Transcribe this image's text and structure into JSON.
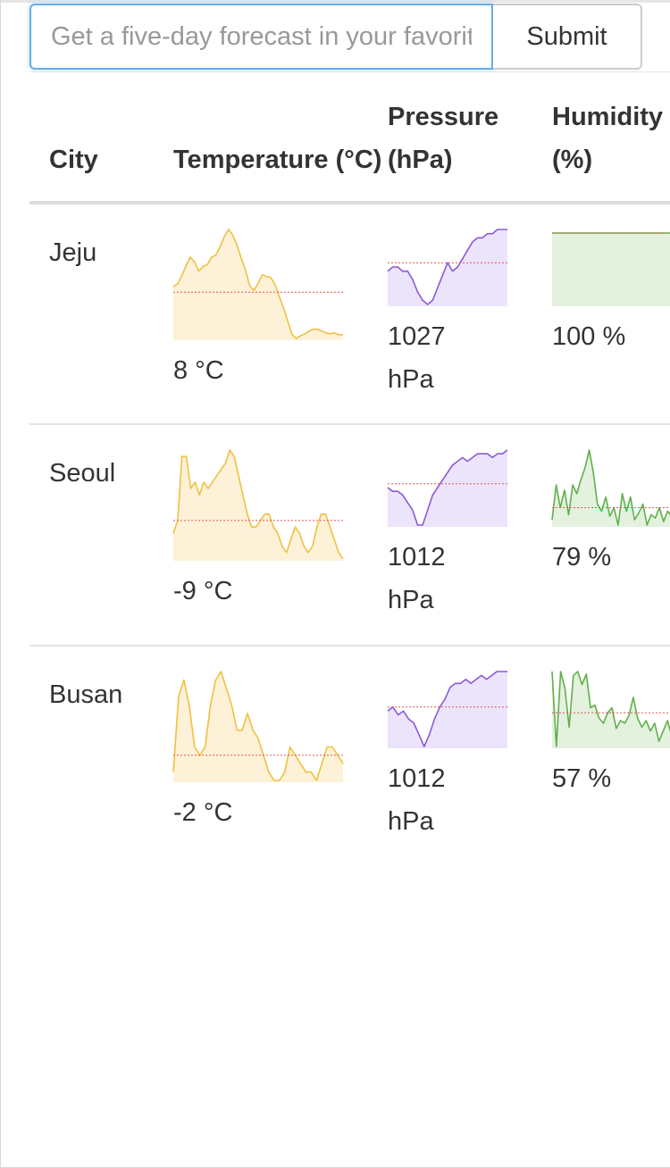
{
  "search": {
    "placeholder": "Get a five-day forecast in your favorite cities",
    "value": "",
    "submit_label": "Submit"
  },
  "table": {
    "headers": {
      "city": "City",
      "temperature": "Temperature (°C)",
      "pressure": "Pressure (hPa)",
      "humidity": "Humidity (%)"
    },
    "rows": [
      {
        "city": "Jeju",
        "temperature": "8 °C",
        "pressure_value": "1027",
        "pressure_unit": "hPa",
        "humidity": "100 %"
      },
      {
        "city": "Seoul",
        "temperature": "-9 °C",
        "pressure_value": "1012",
        "pressure_unit": "hPa",
        "humidity": "79 %"
      },
      {
        "city": "Busan",
        "temperature": "-2 °C",
        "pressure_value": "1012",
        "pressure_unit": "hPa",
        "humidity": "57 %"
      }
    ]
  },
  "colors": {
    "temperature_line": "#f0c040",
    "temperature_fill": "#fdf1d8",
    "pressure_line": "#8a5ad8",
    "pressure_fill": "#ece4fb",
    "humidity_line": "#5fb04a",
    "humidity_fill": "#e3f1de",
    "average_line": "#e35454",
    "input_focus_border": "#66afe9"
  },
  "chart_data": [
    {
      "type": "area",
      "metric": "temperature",
      "city": "Jeju",
      "values": [
        2.0,
        2.3,
        3.2,
        4.3,
        5.2,
        4.7,
        3.7,
        4.2,
        4.4,
        5.2,
        5.4,
        6.3,
        7.4,
        8.2,
        7.6,
        6.5,
        5.1,
        3.8,
        2.1,
        1.6,
        2.4,
        3.3,
        3.1,
        3.0,
        2.2,
        0.9,
        -0.3,
        -1.8,
        -3.2,
        -3.6,
        -3.3,
        -3.1,
        -2.8,
        -2.6,
        -2.6,
        -2.8,
        -3.0,
        -3.1,
        -3.0,
        -3.2,
        -3.2
      ],
      "average": 1.4
    },
    {
      "type": "area",
      "metric": "pressure",
      "city": "Jeju",
      "values": [
        1023,
        1024,
        1024,
        1023,
        1023,
        1021,
        1018,
        1016,
        1015,
        1016,
        1019,
        1022,
        1025,
        1023,
        1024,
        1026,
        1028,
        1030,
        1031,
        1031,
        1032,
        1032,
        1033,
        1033,
        1033
      ],
      "average": 1025
    },
    {
      "type": "area",
      "metric": "humidity",
      "city": "Jeju",
      "values": [
        100,
        100,
        100,
        100,
        100,
        100,
        100,
        100,
        100,
        100
      ],
      "average": 100
    },
    {
      "type": "area",
      "metric": "temperature",
      "city": "Seoul",
      "values": [
        -10,
        -8,
        2,
        2,
        -3,
        -2,
        -4,
        -2,
        -3,
        -2,
        -1,
        0,
        1,
        3,
        2,
        -1,
        -4,
        -7,
        -9,
        -9,
        -8,
        -7,
        -7,
        -9,
        -10,
        -12,
        -13,
        -11,
        -9,
        -10,
        -12,
        -13,
        -12,
        -9,
        -7,
        -7,
        -9,
        -11,
        -13,
        -14
      ],
      "average": -8
    },
    {
      "type": "area",
      "metric": "pressure",
      "city": "Seoul",
      "values": [
        1015,
        1014,
        1014,
        1013,
        1011,
        1009,
        1005,
        1005,
        1009,
        1013,
        1015,
        1017,
        1019,
        1021,
        1022,
        1023,
        1022,
        1023,
        1024,
        1024,
        1024,
        1023,
        1024,
        1024,
        1025
      ],
      "average": 1016
    },
    {
      "type": "area",
      "metric": "humidity",
      "city": "Seoul",
      "values": [
        55,
        75,
        62,
        72,
        58,
        75,
        70,
        78,
        85,
        95,
        82,
        64,
        60,
        68,
        57,
        62,
        52,
        70,
        60,
        68,
        55,
        59,
        64,
        52,
        58,
        56,
        62,
        54,
        60,
        57
      ],
      "average": 62
    },
    {
      "type": "area",
      "metric": "temperature",
      "city": "Busan",
      "values": [
        -3,
        6,
        8,
        5,
        0,
        -1,
        0,
        5,
        8,
        9,
        7,
        5,
        2,
        2,
        4,
        2,
        1,
        -1,
        -3,
        -4,
        -4,
        -3,
        0,
        -1,
        -2,
        -3,
        -3,
        -4,
        -2,
        0,
        0,
        -1,
        -2
      ],
      "average": -1
    },
    {
      "type": "area",
      "metric": "pressure",
      "city": "Busan",
      "values": [
        1014,
        1015,
        1013,
        1014,
        1012,
        1011,
        1008,
        1005,
        1008,
        1012,
        1015,
        1017,
        1020,
        1021,
        1021,
        1022,
        1021,
        1022,
        1023,
        1022,
        1023,
        1024,
        1024,
        1024
      ],
      "average": 1015
    },
    {
      "type": "area",
      "metric": "humidity",
      "city": "Busan",
      "values": [
        98,
        40,
        98,
        85,
        55,
        95,
        98,
        88,
        96,
        70,
        72,
        62,
        58,
        66,
        70,
        54,
        60,
        58,
        64,
        78,
        62,
        55,
        60,
        52,
        58,
        44,
        52,
        60,
        48
      ],
      "average": 66
    }
  ]
}
